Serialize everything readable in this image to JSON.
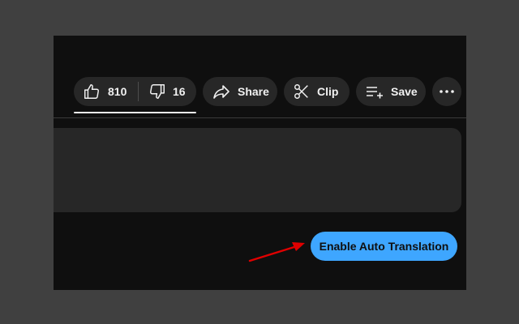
{
  "actions": {
    "like_count": "810",
    "dislike_count": "16",
    "share_label": "Share",
    "clip_label": "Clip",
    "save_label": "Save"
  },
  "translate": {
    "button_label": "Enable Auto Translation"
  },
  "icons": {
    "like": "thumbs-up-icon",
    "dislike": "thumbs-down-icon",
    "share": "share-arrow-icon",
    "clip": "scissors-icon",
    "save": "playlist-add-icon",
    "more": "more-horizontal-icon",
    "annotation": "red-arrow-icon"
  },
  "colors": {
    "panel_bg": "#0f0f0f",
    "pill_bg": "#272727",
    "text": "#f1f1f1",
    "accent_blue": "#3ea6ff",
    "annotation_red": "#e00000"
  }
}
